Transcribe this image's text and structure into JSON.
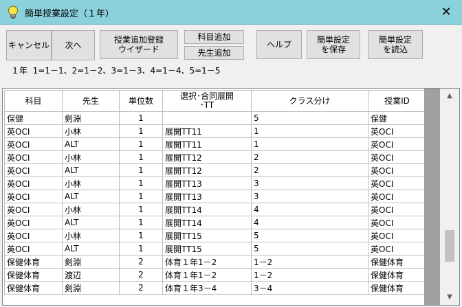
{
  "window": {
    "title": "簡単授業設定（１年）"
  },
  "toolbar": {
    "cancel": "キャンセル",
    "next": "次へ",
    "wizard": "授業追加登録\nウイザード",
    "add_subject": "科目追加",
    "add_teacher": "先生追加",
    "help": "ヘルプ",
    "save_settings": "簡単設定\nを保存",
    "load_settings": "簡単設定\nを読込"
  },
  "info_text": "１年  1=1－1、2=1－2、3=1－3、4=1－4、5=1－5",
  "table": {
    "headers": [
      "科目",
      "先生",
      "単位数",
      "選択･合同展開\n･TT",
      "クラス分け",
      "授業ID"
    ],
    "rows": [
      [
        "保健",
        "剣淵",
        "1",
        "",
        "5",
        "保健"
      ],
      [
        "英OCⅠ",
        "小林",
        "1",
        "展開TT11",
        "1",
        "英OCⅠ"
      ],
      [
        "英OCⅠ",
        "ALT",
        "1",
        "展開TT11",
        "1",
        "英OCⅠ"
      ],
      [
        "英OCⅠ",
        "小林",
        "1",
        "展開TT12",
        "2",
        "英OCⅠ"
      ],
      [
        "英OCⅠ",
        "ALT",
        "1",
        "展開TT12",
        "2",
        "英OCⅠ"
      ],
      [
        "英OCⅠ",
        "小林",
        "1",
        "展開TT13",
        "3",
        "英OCⅠ"
      ],
      [
        "英OCⅠ",
        "ALT",
        "1",
        "展開TT13",
        "3",
        "英OCⅠ"
      ],
      [
        "英OCⅠ",
        "小林",
        "1",
        "展開TT14",
        "4",
        "英OCⅠ"
      ],
      [
        "英OCⅠ",
        "ALT",
        "1",
        "展開TT14",
        "4",
        "英OCⅠ"
      ],
      [
        "英OCⅠ",
        "小林",
        "1",
        "展開TT15",
        "5",
        "英OCⅠ"
      ],
      [
        "英OCⅠ",
        "ALT",
        "1",
        "展開TT15",
        "5",
        "英OCⅠ"
      ],
      [
        "保健体育",
        "剣淵",
        "2",
        "体育１年1－2",
        "1－2",
        "保健体育"
      ],
      [
        "保健体育",
        "渡辺",
        "2",
        "体育１年1－2",
        "1－2",
        "保健体育"
      ],
      [
        "保健体育",
        "剣淵",
        "2",
        "体育１年3－4",
        "3－4",
        "保健体育"
      ]
    ]
  },
  "icons": {
    "title": "lightbulb-icon",
    "close": "close-icon",
    "scroll_up": "arrow-up-icon",
    "scroll_down": "arrow-down-icon"
  },
  "colors": {
    "titlebar": "#8ad1dc",
    "grid_lines": "#bdbdbd",
    "side_strip": "#a0a0a0"
  }
}
